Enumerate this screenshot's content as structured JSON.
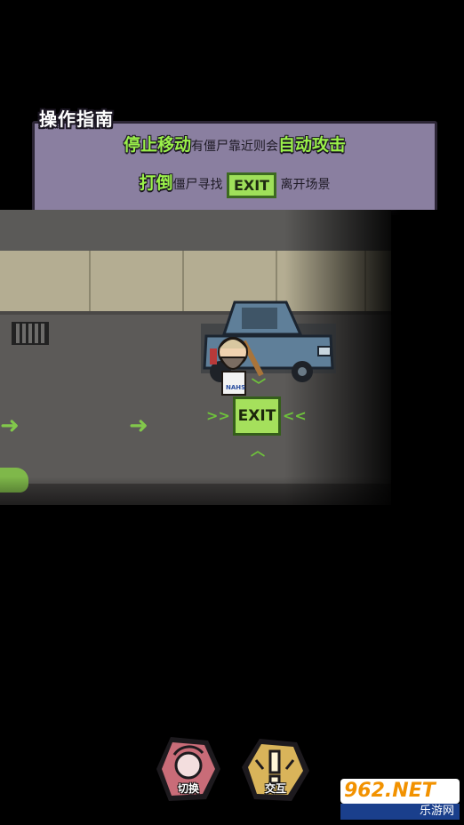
{
  "guide": {
    "title": "操作指南",
    "line1": {
      "hl1": "停止移动",
      "mid": "有僵尸靠近则会",
      "hl2": "自动攻击"
    },
    "line2": {
      "hl1": "打倒",
      "mid": "僵尸寻找",
      "exit_label": "EXIT",
      "tail": "离开场景"
    }
  },
  "scene": {
    "exit_sign": "EXIT",
    "hero_shirt": "NAHS"
  },
  "actions": {
    "switch_label": "切换",
    "interact_label": "交互"
  },
  "watermark": {
    "brand": "962.NET",
    "sub": "乐游网"
  },
  "colors": {
    "highlight": "#9af04a",
    "panel": "#8a7fa0",
    "exit_bg": "#a5e05c",
    "switch_btn": "#c96c78",
    "interact_btn": "#d9b45a"
  }
}
